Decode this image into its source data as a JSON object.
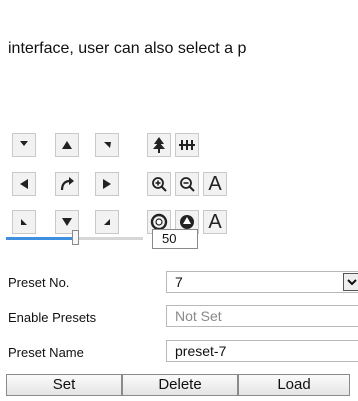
{
  "intro_text": "interface, user can also select a p",
  "ptz": {
    "pad_icons": [
      "arrow-up-left-icon",
      "arrow-up-icon",
      "arrow-up-right-icon",
      "arrow-left-icon",
      "auto-rotate-icon",
      "arrow-right-icon",
      "arrow-down-left-icon",
      "arrow-down-icon",
      "arrow-down-right-icon"
    ],
    "tool_icons": [
      "wiper-icon",
      "light-icon",
      "zoom-in-icon",
      "zoom-out-icon",
      "focus-near-icon",
      "iris-open-icon",
      "iris-close-icon",
      "focus-far-icon"
    ],
    "focus_label": "A",
    "speed_value": "50",
    "speed_level": 0.5
  },
  "preset": {
    "number_label": "Preset No.",
    "number_value": "7",
    "enable_label": "Enable Presets",
    "enable_value": "Not Set",
    "name_label": "Preset Name",
    "name_value": "preset-7"
  },
  "actions": {
    "set": "Set",
    "delete": "Delete",
    "load": "Load"
  },
  "colors": {
    "slider_fill": "#3f8fe0",
    "icon": "#222222"
  }
}
